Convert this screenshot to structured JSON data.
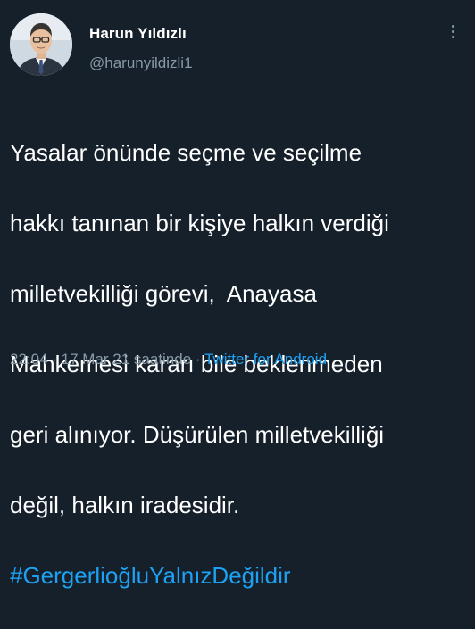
{
  "user": {
    "display_name": "Harun Yıldızlı",
    "handle": "@harunyildizli1"
  },
  "tweet": {
    "lines": [
      "Yasalar önünde seçme ve seçilme",
      "hakkı tanınan bir kişiye halkın verdiği",
      "milletvekilliği görevi,  Anayasa",
      "Mahkemesi kararı bile beklenmeden",
      "geri alınıyor. Düşürülen milletvekilliği",
      "değil, halkın iradesidir."
    ],
    "hashtag": "#GergerlioğluYalnızDeğildir"
  },
  "meta": {
    "time": "22:04",
    "sep1": " · ",
    "date": "17 Mar 21 saatinde",
    "sep2": " · ",
    "source": "Twitter for Android"
  },
  "icons": {
    "more": "more-vertical-icon",
    "avatar": "profile-photo"
  },
  "colors": {
    "background": "#15202b",
    "text": "#ffffff",
    "secondary": "#8899a6",
    "accent": "#1da1f2"
  }
}
